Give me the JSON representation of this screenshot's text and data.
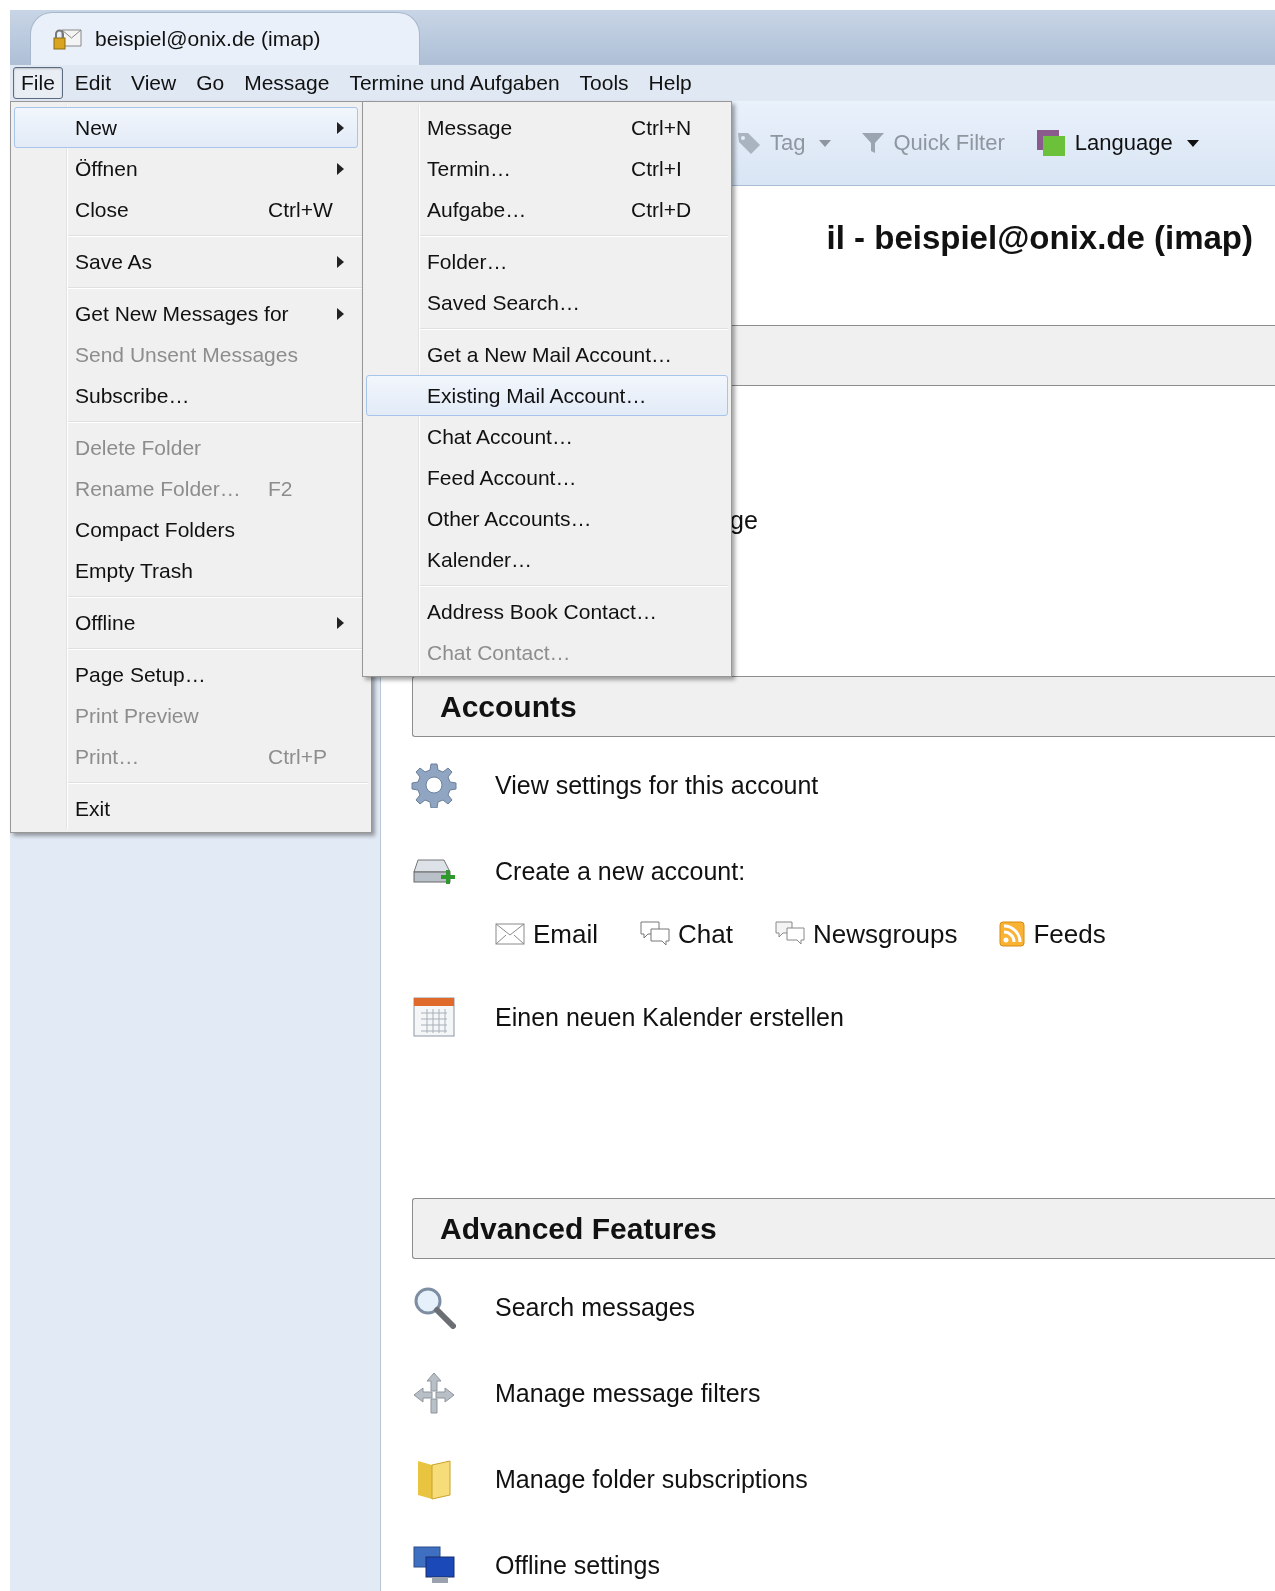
{
  "tab": {
    "title": "beispiel@onix.de (imap)"
  },
  "menubar": [
    {
      "label": "File",
      "selected": true
    },
    {
      "label": "Edit",
      "selected": false
    },
    {
      "label": "View",
      "selected": false
    },
    {
      "label": "Go",
      "selected": false
    },
    {
      "label": "Message",
      "selected": false
    },
    {
      "label": "Termine und Aufgaben",
      "selected": false
    },
    {
      "label": "Tools",
      "selected": false
    },
    {
      "label": "Help",
      "selected": false
    }
  ],
  "toolbar": [
    {
      "kind": "tag",
      "label": "Tag",
      "disabled": true,
      "dropdown": true
    },
    {
      "kind": "filter",
      "label": "Quick Filter",
      "disabled": true,
      "dropdown": false
    },
    {
      "kind": "language",
      "label": "Language",
      "disabled": false,
      "dropdown": true
    }
  ],
  "content": {
    "heading": "il - beispiel@onix.de (imap)",
    "sections": [
      {
        "items": [
          {
            "kind": "fragment",
            "label": "ge"
          }
        ]
      },
      {
        "title": "Accounts",
        "items": [
          {
            "kind": "settings",
            "label": "View settings for this account"
          },
          {
            "kind": "new-account",
            "label": "Create a new account:",
            "links": [
              {
                "kind": "email",
                "label": "Email"
              },
              {
                "kind": "chat",
                "label": "Chat"
              },
              {
                "kind": "newsgroups",
                "label": "Newsgroups"
              },
              {
                "kind": "feeds",
                "label": "Feeds"
              }
            ]
          },
          {
            "kind": "calendar",
            "label": "Einen neuen Kalender erstellen"
          }
        ]
      },
      {
        "title": "Advanced Features",
        "items": [
          {
            "kind": "search",
            "label": "Search messages"
          },
          {
            "kind": "filter",
            "label": "Manage message filters"
          },
          {
            "kind": "folder",
            "label": "Manage folder subscriptions"
          },
          {
            "kind": "offline",
            "label": "Offline settings"
          }
        ]
      }
    ]
  },
  "file_menu": {
    "items": [
      {
        "kind": "item",
        "label": "New",
        "submenu": true,
        "selected": true,
        "disabled": false
      },
      {
        "kind": "item",
        "label": "Öffnen",
        "submenu": true,
        "selected": false,
        "disabled": false
      },
      {
        "kind": "item",
        "label": "Close",
        "shortcut": "Ctrl+W",
        "submenu": false,
        "selected": false,
        "disabled": false
      },
      {
        "kind": "separator"
      },
      {
        "kind": "item",
        "label": "Save As",
        "submenu": true,
        "selected": false,
        "disabled": false
      },
      {
        "kind": "separator"
      },
      {
        "kind": "item",
        "label": "Get New Messages for",
        "submenu": true,
        "selected": false,
        "disabled": false
      },
      {
        "kind": "item",
        "label": "Send Unsent Messages",
        "submenu": false,
        "selected": false,
        "disabled": true
      },
      {
        "kind": "item",
        "label": "Subscribe…",
        "submenu": false,
        "selected": false,
        "disabled": false
      },
      {
        "kind": "separator"
      },
      {
        "kind": "item",
        "label": "Delete Folder",
        "submenu": false,
        "selected": false,
        "disabled": true
      },
      {
        "kind": "item",
        "label": "Rename Folder…",
        "shortcut": "F2",
        "submenu": false,
        "selected": false,
        "disabled": true
      },
      {
        "kind": "item",
        "label": "Compact Folders",
        "submenu": false,
        "selected": false,
        "disabled": false
      },
      {
        "kind": "item",
        "label": "Empty Trash",
        "submenu": false,
        "selected": false,
        "disabled": false
      },
      {
        "kind": "separator"
      },
      {
        "kind": "item",
        "label": "Offline",
        "submenu": true,
        "selected": false,
        "disabled": false
      },
      {
        "kind": "separator"
      },
      {
        "kind": "item",
        "label": "Page Setup…",
        "submenu": false,
        "selected": false,
        "disabled": false
      },
      {
        "kind": "item",
        "label": "Print Preview",
        "submenu": false,
        "selected": false,
        "disabled": true
      },
      {
        "kind": "item",
        "label": "Print…",
        "shortcut": "Ctrl+P",
        "submenu": false,
        "selected": false,
        "disabled": true
      },
      {
        "kind": "separator"
      },
      {
        "kind": "item",
        "label": "Exit",
        "submenu": false,
        "selected": false,
        "disabled": false
      }
    ]
  },
  "new_submenu": {
    "items": [
      {
        "kind": "item",
        "label": "Message",
        "shortcut": "Ctrl+N",
        "submenu": false,
        "selected": false,
        "disabled": false
      },
      {
        "kind": "item",
        "label": "Termin…",
        "shortcut": "Ctrl+I",
        "submenu": false,
        "selected": false,
        "disabled": false
      },
      {
        "kind": "item",
        "label": "Aufgabe…",
        "shortcut": "Ctrl+D",
        "submenu": false,
        "selected": false,
        "disabled": false
      },
      {
        "kind": "separator"
      },
      {
        "kind": "item",
        "label": "Folder…",
        "submenu": false,
        "selected": false,
        "disabled": false
      },
      {
        "kind": "item",
        "label": "Saved Search…",
        "submenu": false,
        "selected": false,
        "disabled": false
      },
      {
        "kind": "separator"
      },
      {
        "kind": "item",
        "label": "Get a New Mail Account…",
        "submenu": false,
        "selected": false,
        "disabled": false
      },
      {
        "kind": "item",
        "label": "Existing Mail Account…",
        "submenu": false,
        "selected": true,
        "disabled": false
      },
      {
        "kind": "item",
        "label": "Chat Account…",
        "submenu": false,
        "selected": false,
        "disabled": false
      },
      {
        "kind": "item",
        "label": "Feed Account…",
        "submenu": false,
        "selected": false,
        "disabled": false
      },
      {
        "kind": "item",
        "label": "Other Accounts…",
        "submenu": false,
        "selected": false,
        "disabled": false
      },
      {
        "kind": "item",
        "label": "Kalender…",
        "submenu": false,
        "selected": false,
        "disabled": false
      },
      {
        "kind": "separator"
      },
      {
        "kind": "item",
        "label": "Address Book Contact…",
        "submenu": false,
        "selected": false,
        "disabled": false
      },
      {
        "kind": "item",
        "label": "Chat Contact…",
        "submenu": false,
        "selected": false,
        "disabled": true
      }
    ]
  }
}
